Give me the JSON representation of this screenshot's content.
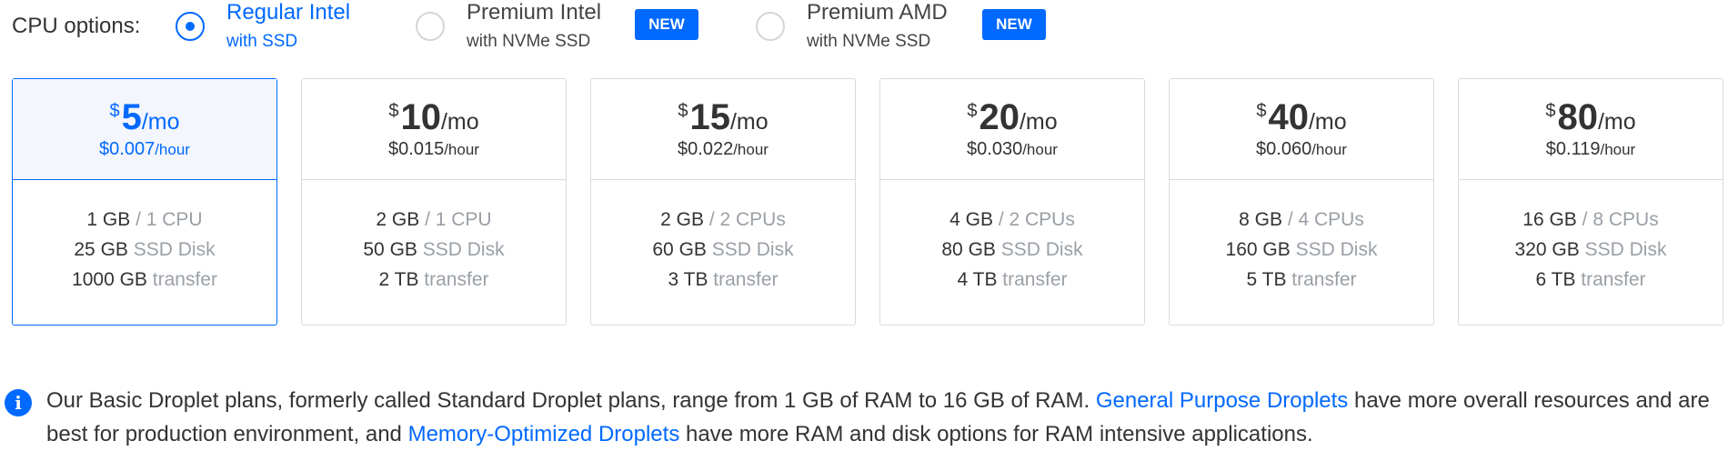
{
  "cpu_options": {
    "label": "CPU options:",
    "options": [
      {
        "title": "Regular Intel",
        "subtitle": "with SSD",
        "selected": true,
        "badge": ""
      },
      {
        "title": "Premium Intel",
        "subtitle": "with NVMe SSD",
        "selected": false,
        "badge": "NEW"
      },
      {
        "title": "Premium AMD",
        "subtitle": "with NVMe SSD",
        "selected": false,
        "badge": "NEW"
      }
    ]
  },
  "plans": [
    {
      "currency": "$",
      "price": "5",
      "per": "/mo",
      "hourly": "$0.007",
      "hour_unit": "/hour",
      "selected": true,
      "memory": "1 GB",
      "memory_sep": " / ",
      "cpu": "1 CPU",
      "disk": "25 GB",
      "disk_unit": " SSD Disk",
      "transfer": "1000 GB",
      "transfer_unit": " transfer"
    },
    {
      "currency": "$",
      "price": "10",
      "per": "/mo",
      "hourly": "$0.015",
      "hour_unit": "/hour",
      "selected": false,
      "memory": "2 GB",
      "memory_sep": " / ",
      "cpu": "1 CPU",
      "disk": "50 GB",
      "disk_unit": " SSD Disk",
      "transfer": "2 TB",
      "transfer_unit": " transfer"
    },
    {
      "currency": "$",
      "price": "15",
      "per": "/mo",
      "hourly": "$0.022",
      "hour_unit": "/hour",
      "selected": false,
      "memory": "2 GB",
      "memory_sep": " / ",
      "cpu": "2 CPUs",
      "disk": "60 GB",
      "disk_unit": " SSD Disk",
      "transfer": "3 TB",
      "transfer_unit": " transfer"
    },
    {
      "currency": "$",
      "price": "20",
      "per": "/mo",
      "hourly": "$0.030",
      "hour_unit": "/hour",
      "selected": false,
      "memory": "4 GB",
      "memory_sep": " / ",
      "cpu": "2 CPUs",
      "disk": "80 GB",
      "disk_unit": " SSD Disk",
      "transfer": "4 TB",
      "transfer_unit": " transfer"
    },
    {
      "currency": "$",
      "price": "40",
      "per": "/mo",
      "hourly": "$0.060",
      "hour_unit": "/hour",
      "selected": false,
      "memory": "8 GB",
      "memory_sep": " / ",
      "cpu": "4 CPUs",
      "disk": "160 GB",
      "disk_unit": " SSD Disk",
      "transfer": "5 TB",
      "transfer_unit": " transfer"
    },
    {
      "currency": "$",
      "price": "80",
      "per": "/mo",
      "hourly": "$0.119",
      "hour_unit": "/hour",
      "selected": false,
      "memory": "16 GB",
      "memory_sep": " / ",
      "cpu": "8 CPUs",
      "disk": "320 GB",
      "disk_unit": " SSD Disk",
      "transfer": "6 TB",
      "transfer_unit": " transfer"
    }
  ],
  "info": {
    "icon": "info-icon",
    "text_1": "Our Basic Droplet plans, formerly called Standard Droplet plans, range from 1 GB of RAM to 16 GB of RAM. ",
    "link_1": "General Purpose Droplets",
    "text_2": " have more overall resources and are best for production environment, and ",
    "link_2": "Memory-Optimized Droplets",
    "text_3": " have more RAM and disk options for RAM intensive applications."
  },
  "colors": {
    "accent": "#0069ff",
    "border": "#d9dce0",
    "muted": "#9aa0a6",
    "selected_bg": "#f3f6fd"
  }
}
